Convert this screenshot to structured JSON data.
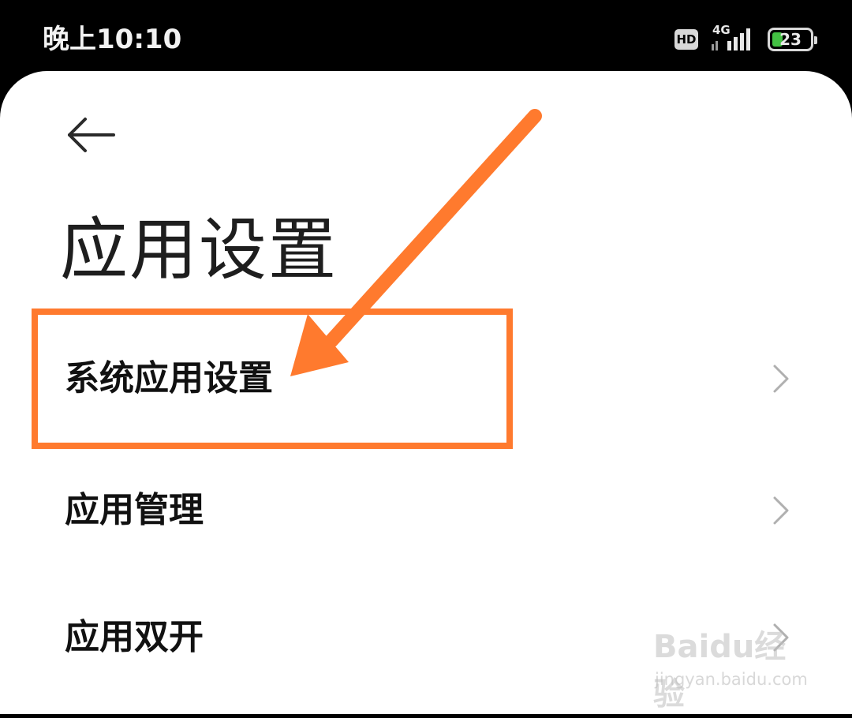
{
  "status_bar": {
    "time": "晚上10:10",
    "hd_label": "HD",
    "network_type": "4G",
    "battery_level": "23",
    "battery_color": "#43c043"
  },
  "page": {
    "title": "应用设置",
    "back_icon": "arrow-left-icon"
  },
  "menu": {
    "items": [
      {
        "label": "系统应用设置",
        "icon": "chevron-right-icon"
      },
      {
        "label": "应用管理",
        "icon": "chevron-right-icon"
      },
      {
        "label": "应用双开",
        "icon": "chevron-right-icon"
      }
    ]
  },
  "annotation": {
    "color": "#ff7a2e",
    "target": "系统应用设置"
  },
  "watermark": {
    "logo": "Baidu经验",
    "url": "jingyan.baidu.com"
  }
}
